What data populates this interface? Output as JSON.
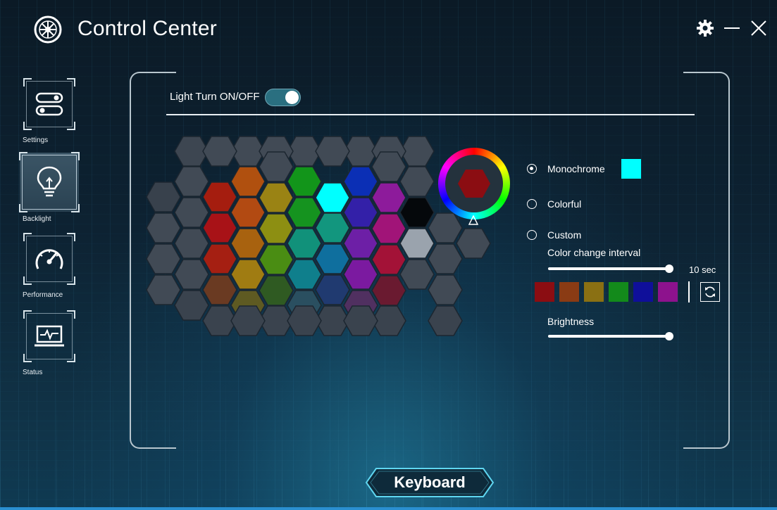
{
  "app": {
    "title": "Control Center"
  },
  "sidebar": {
    "items": [
      {
        "label": "Settings",
        "icon": "toggle-switches-icon"
      },
      {
        "label": "Backlight",
        "icon": "lightbulb-icon",
        "active": true
      },
      {
        "label": "Performance",
        "icon": "speedometer-icon"
      },
      {
        "label": "Status",
        "icon": "laptop-monitor-icon"
      }
    ]
  },
  "light": {
    "label": "Light Turn ON/OFF",
    "on": true
  },
  "modes": {
    "monochrome": {
      "label": "Monochrome",
      "selected": true,
      "color": "#00ffff"
    },
    "colorful": {
      "label": "Colorful",
      "selected": false
    },
    "custom": {
      "label": "Custom",
      "selected": false
    }
  },
  "interval": {
    "label": "Color change interval",
    "value": "10 sec",
    "level": 1.0
  },
  "palette": [
    "#8b0d12",
    "#8a3b14",
    "#8a7013",
    "#138a1b",
    "#0f0f9a",
    "#8d128d"
  ],
  "brightness": {
    "label": "Brightness",
    "level": 1.0
  },
  "color_wheel": {
    "selected_color": "#8b0d12"
  },
  "bottom_tab": {
    "label": "Keyboard"
  },
  "colors": {
    "accent_cyan": "#00ffff",
    "red": "#a81217",
    "orange": "#b24a12",
    "olive": "#9a8314",
    "green": "#15931f",
    "teal": "#12967e",
    "blue": "#0b2fb5",
    "purple": "#8d1b9b",
    "magenta": "#a11478",
    "crimson": "#a31237",
    "grey_key": "#9aa3ad",
    "black_key": "#05080b",
    "dark_key": "#3b4552"
  },
  "keyboard_hex": [
    {
      "c": "#3d4651",
      "k": "dark_key"
    },
    {
      "c": "#414a55",
      "k": "dark_key"
    },
    {
      "c": "#414a55",
      "k": "dark_key"
    },
    {
      "c": "#414a55",
      "k": "dark_key"
    },
    {
      "c": "#414a55",
      "k": "dark_key"
    },
    {
      "c": "#414a55",
      "k": "dark_key"
    },
    {
      "c": "#414a55",
      "k": "dark_key"
    },
    {
      "c": "#414a55",
      "k": "dark_key"
    },
    {
      "c": "#414a55",
      "k": "dark_key"
    },
    {
      "c": "#38414c",
      "k": "dark_key"
    },
    {
      "c": "#414a55",
      "k": "dark_key"
    },
    {
      "c": "#a51d0f",
      "k": "red"
    },
    {
      "c": "#b0500f",
      "k": "orange"
    },
    {
      "c": "#414a55",
      "k": "dark_key"
    },
    {
      "c": "#12951a",
      "k": "green"
    },
    {
      "c": "#00ffff",
      "k": "accent_cyan"
    },
    {
      "c": "#0b2fb5",
      "k": "blue"
    },
    {
      "c": "#414a55",
      "k": "dark_key"
    },
    {
      "c": "#414a55",
      "k": "dark_key"
    },
    {
      "c": "#414a55",
      "k": "dark_key"
    },
    {
      "c": "#414a55",
      "k": "dark_key"
    },
    {
      "c": "#a81217",
      "k": "red"
    },
    {
      "c": "#b24a12",
      "k": "orange"
    },
    {
      "c": "#9a8314",
      "k": "olive"
    },
    {
      "c": "#15931f",
      "k": "green"
    },
    {
      "c": "#12967e",
      "k": "teal"
    },
    {
      "c": "#3320a8",
      "k": "blue"
    },
    {
      "c": "#8d1b9b",
      "k": "purple"
    },
    {
      "c": "#05080b",
      "k": "black_key"
    },
    {
      "c": "#414a55",
      "k": "dark_key"
    },
    {
      "c": "#414a55",
      "k": "dark_key"
    },
    {
      "c": "#a51f12",
      "k": "red"
    },
    {
      "c": "#a8620f",
      "k": "orange"
    },
    {
      "c": "#8d8f12",
      "k": "olive"
    },
    {
      "c": "#11917a",
      "k": "teal"
    },
    {
      "c": "#0f6f9e",
      "k": "blue"
    },
    {
      "c": "#6d1fa6",
      "k": "purple"
    },
    {
      "c": "#a11478",
      "k": "magenta"
    },
    {
      "c": "#9aa3ad",
      "k": "grey_key"
    },
    {
      "c": "#414a55",
      "k": "dark_key"
    },
    {
      "c": "#414a55",
      "k": "dark_key"
    },
    {
      "c": "#414a55",
      "k": "dark_key"
    },
    {
      "c": "#a83412",
      "k": "orange"
    },
    {
      "c": "#a07c12",
      "k": "olive"
    },
    {
      "c": "#4a8d13",
      "k": "green"
    },
    {
      "c": "#0f7f8c",
      "k": "teal"
    },
    {
      "c": "#1b3ab0",
      "k": "blue"
    },
    {
      "c": "#7b1aa0",
      "k": "purple"
    },
    {
      "c": "#a31237",
      "k": "crimson"
    },
    {
      "c": "#414a55",
      "k": "dark_key"
    },
    {
      "c": "#414a55",
      "k": "dark_key"
    },
    {
      "c": "#414a55",
      "k": "dark_key"
    },
    {
      "c": "#6a3a22",
      "k": "orange"
    },
    {
      "c": "#5e5a22",
      "k": "olive"
    },
    {
      "c": "#2f5a22",
      "k": "green"
    },
    {
      "c": "#2a4f60",
      "k": "teal"
    },
    {
      "c": "#203a70",
      "k": "blue"
    },
    {
      "c": "#503060",
      "k": "purple"
    },
    {
      "c": "#6a1a30",
      "k": "crimson"
    },
    {
      "c": "#414a55",
      "k": "dark_key"
    },
    {
      "c": "#414a55",
      "k": "dark_key"
    },
    {
      "c": "#3a434e",
      "k": "dark_key"
    },
    {
      "c": "#3a434e",
      "k": "dark_key"
    },
    {
      "c": "#3a434e",
      "k": "dark_key"
    },
    {
      "c": "#3a434e",
      "k": "dark_key"
    },
    {
      "c": "#3a434e",
      "k": "dark_key"
    },
    {
      "c": "#3a434e",
      "k": "dark_key"
    },
    {
      "c": "#3a434e",
      "k": "dark_key"
    },
    {
      "c": "#3a434e",
      "k": "dark_key"
    },
    {
      "c": "#3a434e",
      "k": "dark_key"
    }
  ]
}
